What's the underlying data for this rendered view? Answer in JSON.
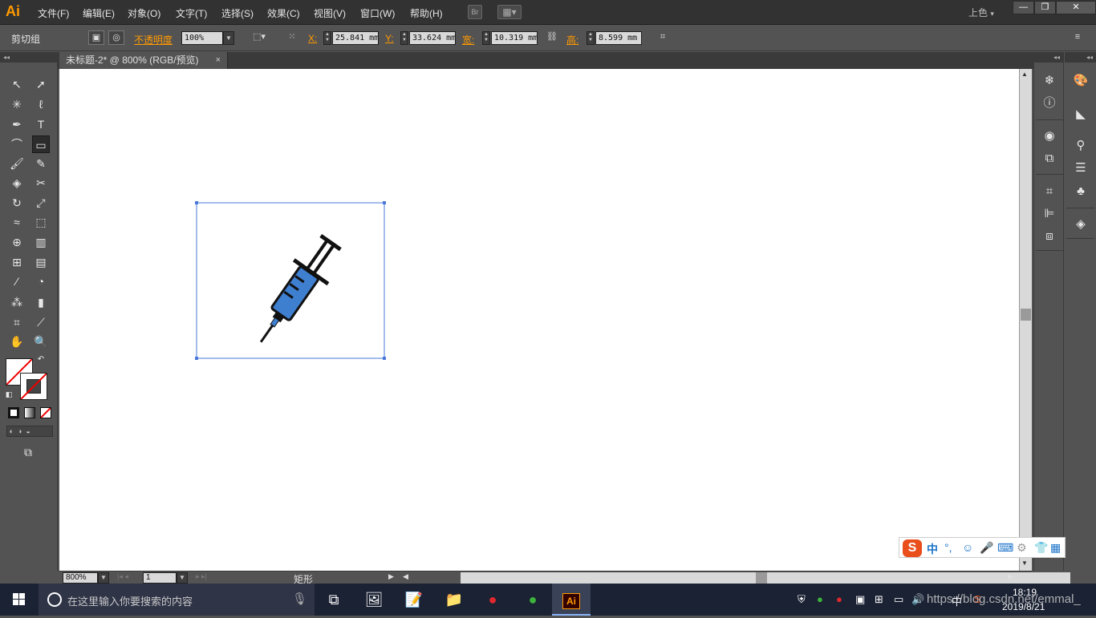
{
  "app": {
    "logo": "Ai"
  },
  "menu": [
    "文件(F)",
    "编辑(E)",
    "对象(O)",
    "文字(T)",
    "选择(S)",
    "效果(C)",
    "视图(V)",
    "窗口(W)",
    "帮助(H)"
  ],
  "menubar": {
    "bridge_label": "Br",
    "workspace": "上色",
    "workspace_arrow": "▾"
  },
  "window_controls": {
    "minimize": "—",
    "restore": "❐",
    "close": "✕"
  },
  "control_bar": {
    "selection_label": "剪切组",
    "opacity_label": "不透明度",
    "opacity_value": "100%",
    "x_label": "X:",
    "x_value": "25.841 mm",
    "y_label": "Y:",
    "y_value": "33.624 mm",
    "w_label": "宽:",
    "w_value": "10.319 mm",
    "h_label": "高:",
    "h_value": "8.599 mm"
  },
  "document": {
    "tab_title": "未标题-2* @ 800% (RGB/预览)",
    "close": "×"
  },
  "status": {
    "zoom": "800%",
    "artboard": "1",
    "info": "矩形"
  },
  "ime": {
    "logo": "S",
    "lang": "中",
    "punct": "°,",
    "items": [
      "☺",
      "🎤",
      "⌨",
      "⚙",
      "👕",
      "▦"
    ]
  },
  "taskbar": {
    "search_placeholder": "在这里输入你要搜索的内容",
    "time": "18:19",
    "date": "2019/8/21",
    "tray_ime": "中",
    "watermark": "https://blog.csdn.net/emmal_"
  },
  "colors": {
    "accent": "#ff9a00",
    "selection": "#4a78d8",
    "syringe_fill": "#3f7fd0"
  }
}
